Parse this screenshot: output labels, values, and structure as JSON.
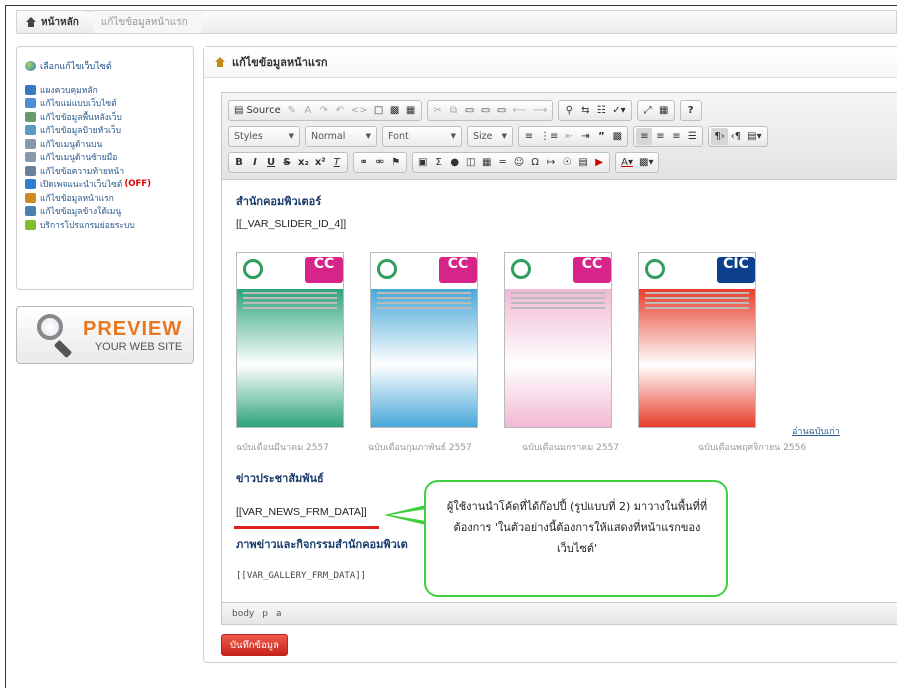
{
  "breadcrumb": {
    "home": "หน้าหลัก",
    "current": "แก้ไขข้อมูลหน้าแรก"
  },
  "sidebar": {
    "header": "เลือกแก้ไขเว็บไซต์",
    "items": [
      {
        "label": "แผงควบคุมหลัก",
        "icon": "dashboard-icon",
        "color": "#3b78c2"
      },
      {
        "label": "แก้ไขแม่แบบเว็บไซต์",
        "icon": "template-icon",
        "color": "#4c8fd4"
      },
      {
        "label": "แก้ไขข้อมูลพื้นหลังเว็บ",
        "icon": "background-icon",
        "color": "#6a9a6a"
      },
      {
        "label": "แก้ไขข้อมูลป้ายหัวเว็บ",
        "icon": "banner-icon",
        "color": "#5a9ac0"
      },
      {
        "label": "แก้ไขเมนูด้านบน",
        "icon": "top-menu-icon",
        "color": "#8899aa"
      },
      {
        "label": "แก้ไขเมนูด้านซ้ายมือ",
        "icon": "left-menu-icon",
        "color": "#8899aa"
      },
      {
        "label": "แก้ไขข้อความท้ายหน้า",
        "icon": "footer-icon",
        "color": "#6a7f99"
      },
      {
        "label": "เปิดเพจแนะนำเว็บไซต์",
        "suffix": "(OFF)",
        "icon": "intro-page-icon",
        "color": "#2f7fd0"
      },
      {
        "label": "แก้ไขข้อมูลหน้าแรก",
        "icon": "home-page-icon",
        "color": "#d08a22"
      },
      {
        "label": "แก้ไขข้อมูลข้างใต้เมนู",
        "icon": "under-menu-icon",
        "color": "#4a7fb0"
      },
      {
        "label": "บริการโปรแกรมย่อยระบบ",
        "icon": "service-icon",
        "color": "#7fbf2f"
      }
    ]
  },
  "preview": {
    "big": "PREVIEW",
    "small": "YOUR WEB SITE"
  },
  "main": {
    "title": "แก้ไขข้อมูลหน้าแรก"
  },
  "toolbar": {
    "source_label": "Source",
    "styles": "Styles",
    "format": "Normal",
    "font": "Font",
    "size": "Size"
  },
  "content": {
    "heading": "สำนักคอมพิวเตอร์",
    "slider_var": "[[_VAR_SLIDER_ID_4]]",
    "covers": [
      {
        "caption": "ฉบับเดือนมีนาคม 2557",
        "band": "CC",
        "band_color": "#d6248a",
        "body_color": "#2da37a"
      },
      {
        "caption": "ฉบับเดือนกุมภาพันธ์ 2557",
        "band": "CC",
        "band_color": "#d6248a",
        "body_color": "#47a7d8"
      },
      {
        "caption": "ฉบับเดือนมกราคม 2557",
        "band": "CC",
        "band_color": "#d6248a",
        "body_color": "#f2b8d4"
      },
      {
        "caption": "ฉบับเดือนพฤศจิกายน 2556",
        "band": "CIC",
        "band_color": "#0d3f8f",
        "body_color": "#e83d2a"
      }
    ],
    "read_more": "อ่านฉบับเก่า",
    "news_heading": "ข่าวประชาสัมพันธ์",
    "news_var": "[[VAR_NEWS_FRM_DATA]]",
    "gallery_heading": "ภาพข่าวและกิจกรรมสำนักคอมพิวเต",
    "gallery_var": "[[VAR_GALLERY_FRM_DATA]]"
  },
  "statusbar": {
    "path": [
      "body",
      "p",
      "a"
    ]
  },
  "save_button": "บันทึกข้อมูล",
  "callout": "ผู้ใช้งานนำโค้ดที่ได้ก๊อปปี้ (รูปแบบที่ 2) มาวางในพื้นที่ที่ต้องการ 'ในตัวอย่างนี้ต้องการให้แสดงที่หน้าแรกของเว็บไซต์'"
}
